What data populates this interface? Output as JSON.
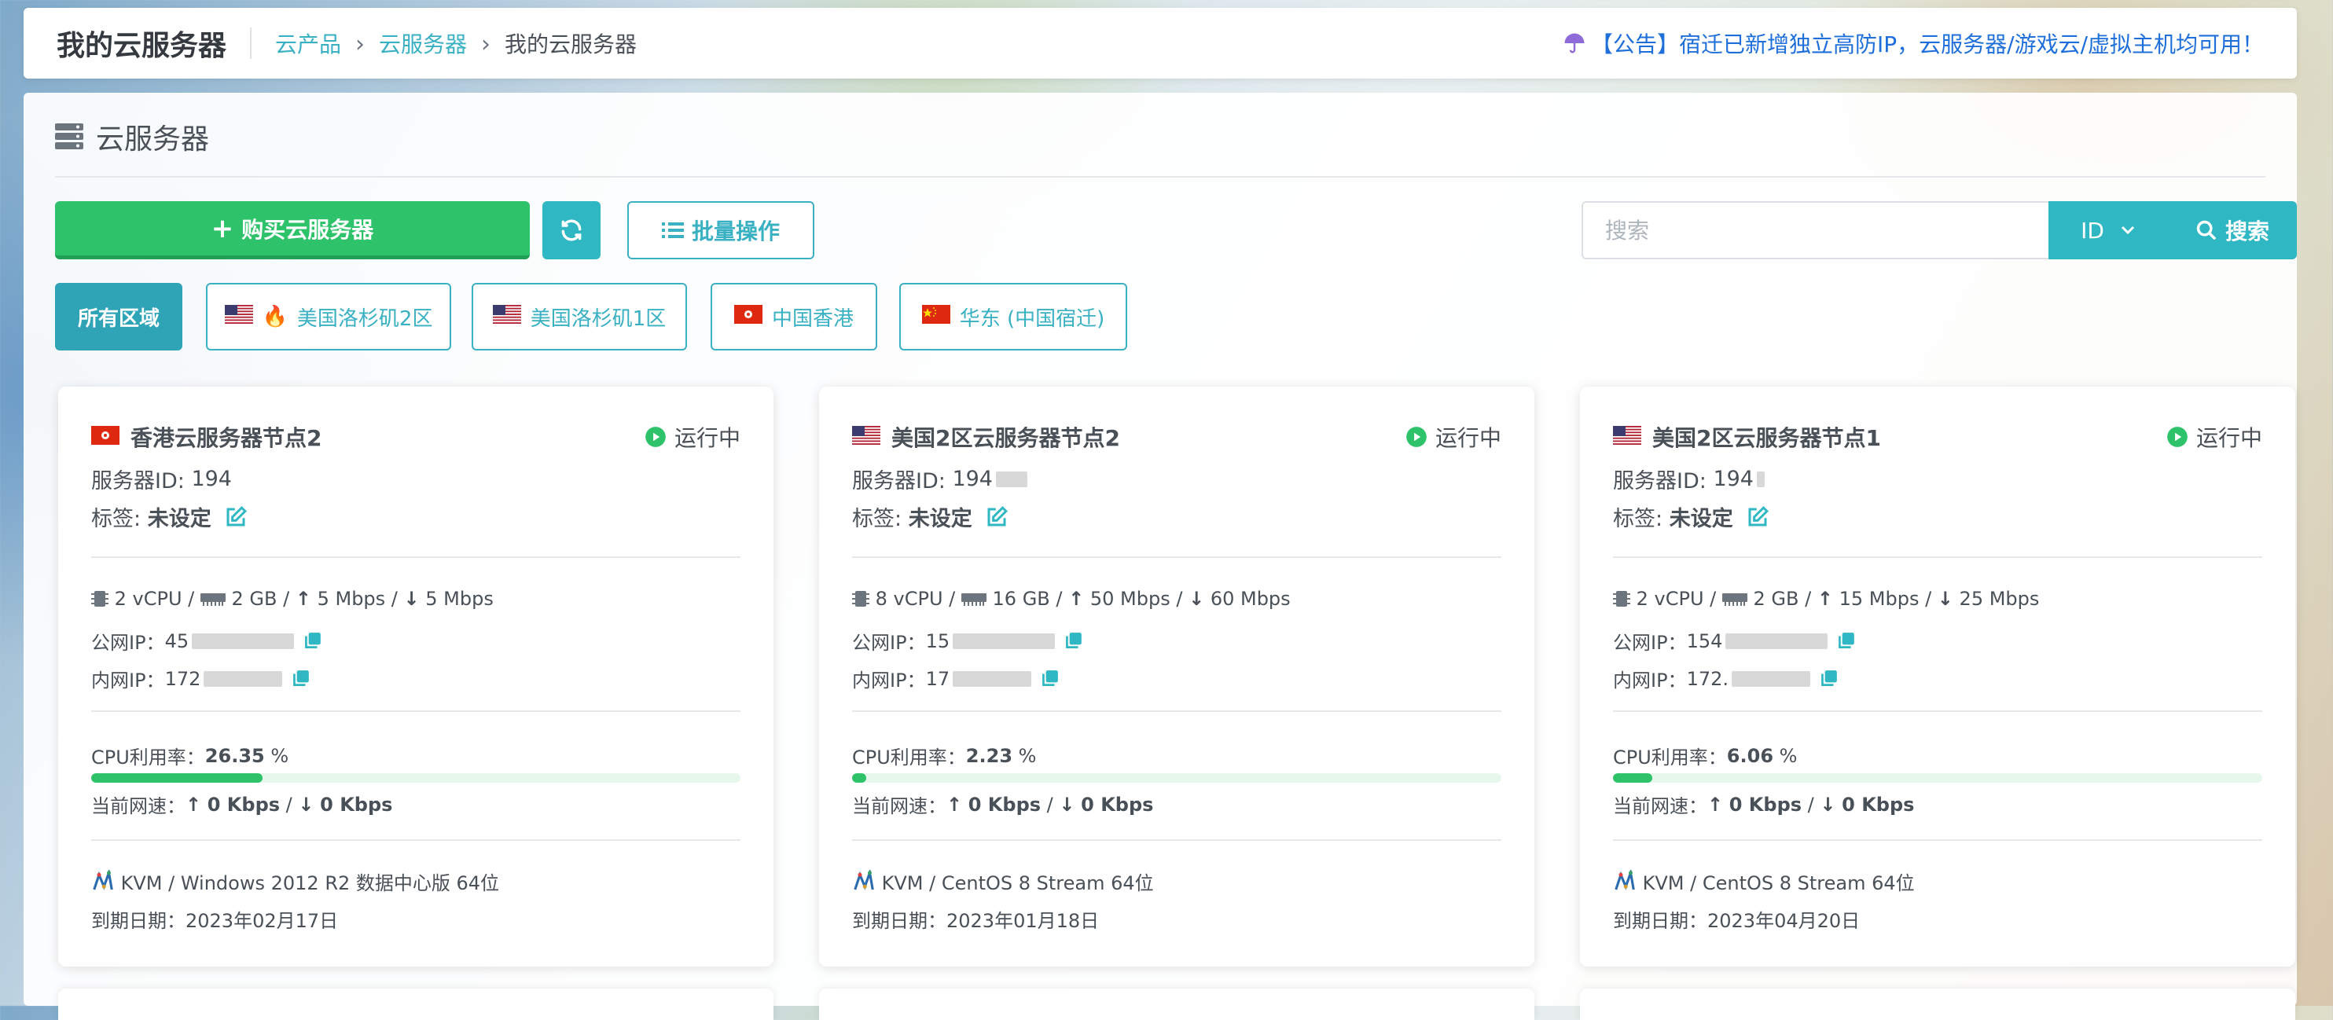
{
  "topbar": {
    "title": "我的云服务器",
    "breadcrumb": [
      "云产品",
      "云服务器",
      "我的云服务器"
    ],
    "notice": "【公告】宿迁已新增独立高防IP，云服务器/游戏云/虚拟主机均可用！"
  },
  "section_title": "云服务器",
  "toolbar": {
    "buy_label": "购买云服务器",
    "batch_label": "批量操作",
    "search_placeholder": "搜索",
    "search_field": "ID",
    "search_button": "搜索"
  },
  "regions": [
    {
      "label": "所有区域",
      "flag": "",
      "fire": false,
      "active": true
    },
    {
      "label": "美国洛杉矶2区",
      "flag": "us",
      "fire": true,
      "active": false
    },
    {
      "label": "美国洛杉矶1区",
      "flag": "us",
      "fire": false,
      "active": false
    },
    {
      "label": "中国香港",
      "flag": "hk",
      "fire": false,
      "active": false
    },
    {
      "label": "华东 (中国宿迁)",
      "flag": "cn",
      "fire": false,
      "active": false
    }
  ],
  "common": {
    "status_label": "运行中",
    "server_id_label": "服务器ID:",
    "tag_label": "标签:",
    "public_ip_label": "公网IP：",
    "private_ip_label": "内网IP：",
    "cpu_label": "CPU利用率：",
    "net_label": "当前网速：",
    "expire_label": "到期日期："
  },
  "servers": [
    {
      "name": "香港云服务器节点2",
      "flag": "hk",
      "id": "194",
      "tag": "未设定",
      "vcpu": "2 vCPU",
      "ram": "2 GB",
      "up": "5 Mbps",
      "down": "5 Mbps",
      "public_ip": "45",
      "private_ip": "172",
      "cpu_usage": "26.35",
      "cpu_unit": "%",
      "cpu_fraction": 0.2635,
      "net_up": "0 Kbps",
      "net_down": "0 Kbps",
      "os": "KVM / Windows 2012 R2 数据中心版 64位",
      "expire": "2023年02月17日"
    },
    {
      "name": "美国2区云服务器节点2",
      "flag": "us",
      "id": "194",
      "tag": "未设定",
      "vcpu": "8 vCPU",
      "ram": "16 GB",
      "up": "50 Mbps",
      "down": "60 Mbps",
      "public_ip": "15",
      "private_ip": "17",
      "cpu_usage": "2.23",
      "cpu_unit": "%",
      "cpu_fraction": 0.0223,
      "net_up": "0 Kbps",
      "net_down": "0 Kbps",
      "os": "KVM / CentOS 8 Stream 64位",
      "expire": "2023年01月18日"
    },
    {
      "name": "美国2区云服务器节点1",
      "flag": "us",
      "id": "194",
      "tag": "未设定",
      "vcpu": "2 vCPU",
      "ram": "2 GB",
      "up": "15 Mbps",
      "down": "25 Mbps",
      "public_ip": "154",
      "private_ip": "172.",
      "cpu_usage": "6.06",
      "cpu_unit": "%",
      "cpu_fraction": 0.0606,
      "net_up": "0 Kbps",
      "net_down": "0 Kbps",
      "os": "KVM / CentOS 8 Stream 64位",
      "expire": "2023年04月20日"
    }
  ]
}
